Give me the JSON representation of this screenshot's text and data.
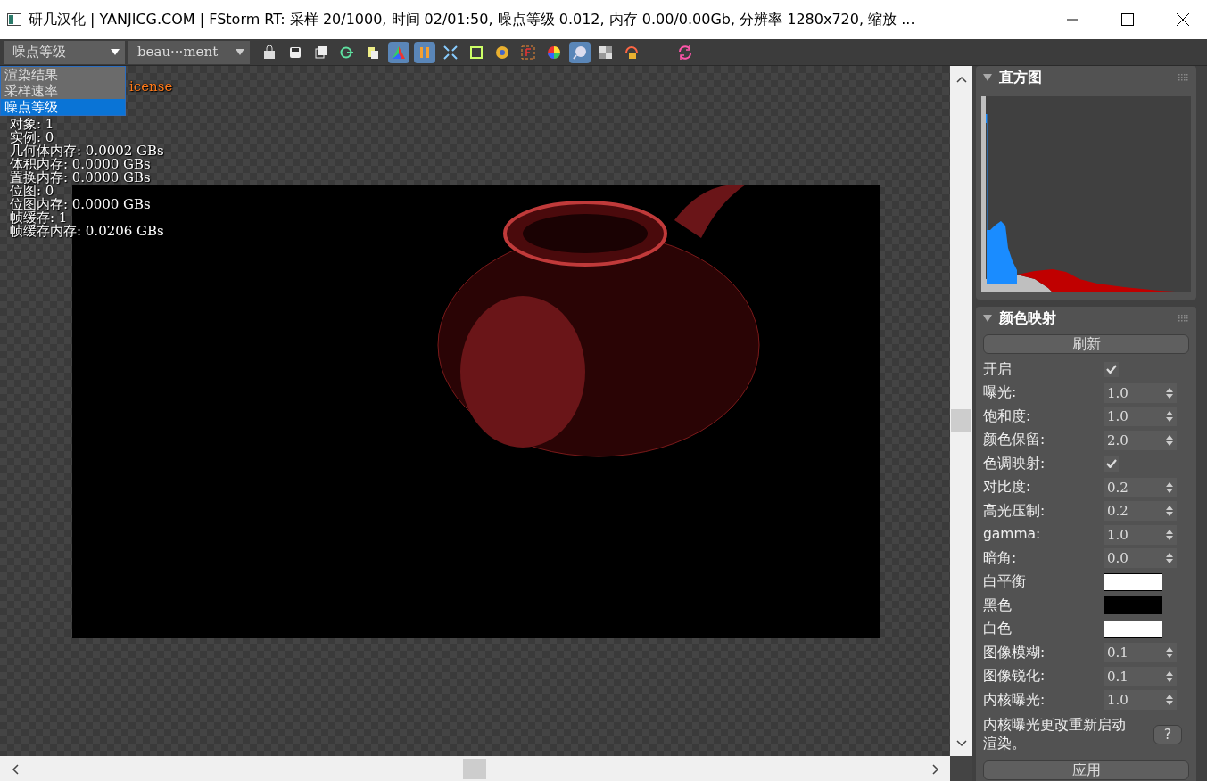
{
  "window": {
    "title": "研几汉化 | YANJICG.COM | FStorm RT: 采样 20/1000,  时间 02/01:50,  噪点等级 0.012,  内存 0.00/0.00Gb,  分辨率 1280x720,  缩放 ..."
  },
  "toolbar": {
    "combos": [
      {
        "value": "噪点等级",
        "open": true
      },
      {
        "value": "beau···ment",
        "open": false
      }
    ],
    "buttons": [
      {
        "pressed": false
      },
      {
        "pressed": false
      },
      {
        "pressed": false
      },
      {
        "pressed": false
      },
      {
        "pressed": false
      },
      {
        "pressed": true
      },
      {
        "pressed": true
      },
      {
        "pressed": false
      },
      {
        "pressed": false
      },
      {
        "pressed": false
      },
      {
        "pressed": false
      },
      {
        "pressed": false
      },
      {
        "pressed": true
      },
      {
        "pressed": false
      },
      {
        "pressed": false
      },
      {
        "pressed": false
      }
    ]
  },
  "dropdown_menu": [
    {
      "label": "渲染结果",
      "selected": false
    },
    {
      "label": "采样速率",
      "selected": false
    },
    {
      "label": "噪点等级",
      "selected": true
    }
  ],
  "overlay_lines": [
    {
      "text": "icense",
      "kind": "warning"
    },
    {
      "text": "对象: 1",
      "kind": "info"
    },
    {
      "text": "实例: 0",
      "kind": "info"
    },
    {
      "text": "几何体内存: 0.0002 GBs",
      "kind": "info"
    },
    {
      "text": "体积内存: 0.0000 GBs",
      "kind": "info"
    },
    {
      "text": "置换内存: 0.0000 GBs",
      "kind": "info"
    },
    {
      "text": "位图: 0",
      "kind": "info"
    },
    {
      "text": "位图内存: 0.0000 GBs",
      "kind": "info"
    },
    {
      "text": "帧缓存: 1",
      "kind": "info"
    },
    {
      "text": "帧缓存内存: 0.0206 GBs",
      "kind": "info"
    }
  ],
  "histogram": {
    "title": "直方图",
    "expanded": true
  },
  "color_mapping": {
    "title": "颜色映射",
    "expanded": true,
    "refresh_button": "刷新",
    "rows": [
      {
        "kind": "checkbox",
        "label": "开启",
        "checked": true
      },
      {
        "kind": "spin",
        "label": "曝光:",
        "value": "1.0"
      },
      {
        "kind": "spin",
        "label": "饱和度:",
        "value": "1.0"
      },
      {
        "kind": "spin",
        "label": "颜色保留:",
        "value": "2.0"
      },
      {
        "kind": "checkbox",
        "label": "色调映射:",
        "checked": true
      },
      {
        "kind": "spin",
        "label": "对比度:",
        "value": "0.2"
      },
      {
        "kind": "spin",
        "label": "高光压制:",
        "value": "0.2"
      },
      {
        "kind": "spin",
        "label": "gamma:",
        "value": "1.0"
      },
      {
        "kind": "spin",
        "label": "暗角:",
        "value": "0.0"
      },
      {
        "kind": "color",
        "label": "白平衡",
        "color": "#ffffff"
      },
      {
        "kind": "color",
        "label": "黑色",
        "color": "#000000"
      },
      {
        "kind": "color",
        "label": "白色",
        "color": "#ffffff"
      },
      {
        "kind": "spin",
        "label": "图像模糊:",
        "value": "0.1"
      },
      {
        "kind": "spin",
        "label": "图像锐化:",
        "value": "0.1"
      },
      {
        "kind": "spin",
        "label": "内核曝光:",
        "value": "1.0"
      }
    ],
    "note": "内核曝光更改重新启动渲染。",
    "help_button": "?",
    "apply_button": "应用"
  }
}
